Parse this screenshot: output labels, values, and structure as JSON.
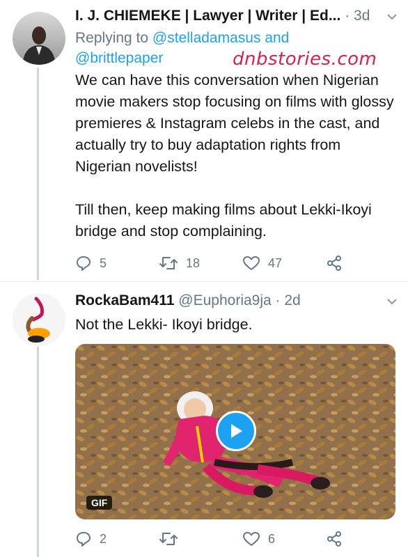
{
  "watermark": "dnbstories.com",
  "tweets": [
    {
      "name": "I. J. CHIEMEKE | Lawyer | Writer | Ed...",
      "handle": "",
      "dot": "·",
      "time": "3d",
      "reply_prefix": "Replying to",
      "reply_to_1": "@stelladamasus",
      "reply_and": "and",
      "reply_to_2": "@brittlepaper",
      "text_p1": "We can have this conversation when Nigerian movie makers stop focusing on films with glossy premieres & Instagram celebs in the cast, and actually try to buy adaptation rights from Nigerian novelists!",
      "text_p2": "Till then, keep making films about Lekki-Ikoyi bridge and stop complaining.",
      "replies": "5",
      "retweets": "18",
      "likes": "47",
      "avatar_icon": "person-in-suit-avatar"
    },
    {
      "name": "RockaBam411",
      "handle": "@Euphoria9ja",
      "dot": "·",
      "time": "2d",
      "text_p1": "Not the Lekki- Ikoyi bridge.",
      "media_badge": "GIF",
      "replies": "2",
      "retweets": "",
      "likes": "6",
      "avatar_icon": "leaning-figure-avatar"
    }
  ],
  "colors": {
    "accent": "#1da1f2",
    "secondary_text": "#657786",
    "watermark": "#d6224d",
    "divider": "#e6ecf0"
  }
}
